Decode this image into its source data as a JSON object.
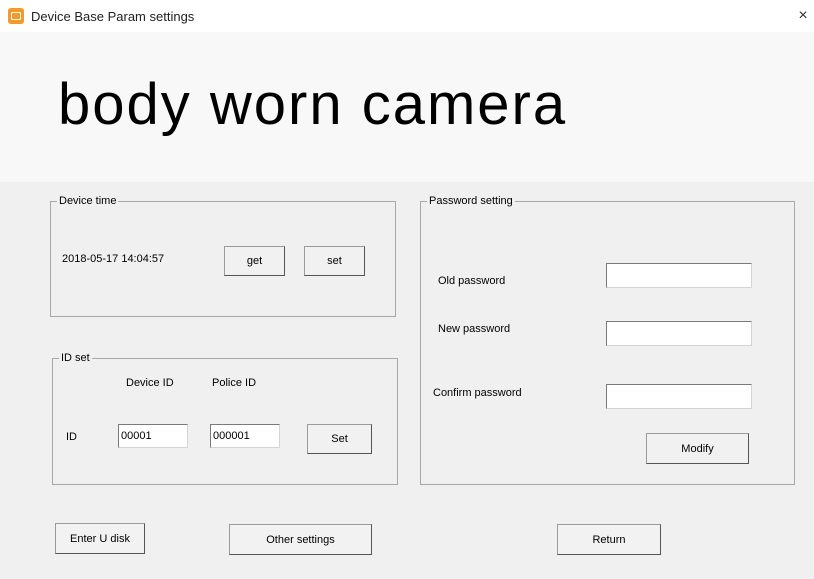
{
  "window": {
    "title": "Device Base Param settings",
    "close_glyph": "×",
    "icon": "app-icon"
  },
  "banner": {
    "text": "body worn camera"
  },
  "device_time": {
    "legend": "Device time",
    "value": "2018-05-17 14:04:57",
    "get_label": "get",
    "set_label": "set"
  },
  "id_set": {
    "legend": "ID set",
    "device_id_header": "Device ID",
    "police_id_header": "Police ID",
    "row_label": "ID",
    "device_id_value": "00001",
    "police_id_value": "000001",
    "set_label": "Set"
  },
  "password": {
    "legend": "Password setting",
    "old_label": "Old password",
    "new_label": "New password",
    "confirm_label": "Confirm password",
    "old_value": "",
    "new_value": "",
    "confirm_value": "",
    "modify_label": "Modify"
  },
  "footer": {
    "enter_u_disk_label": "Enter U disk",
    "other_settings_label": "Other settings",
    "return_label": "Return"
  }
}
